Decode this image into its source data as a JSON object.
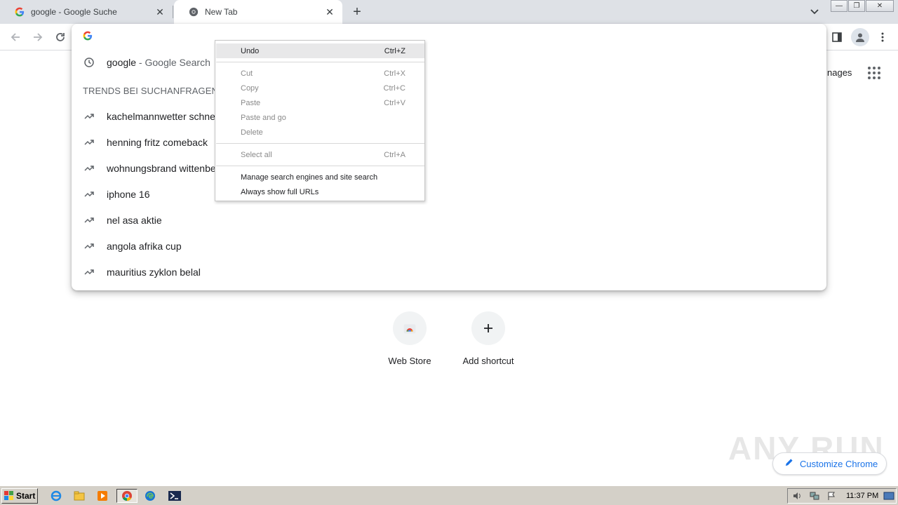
{
  "tabs": [
    {
      "title": "google - Google Suche",
      "active": false
    },
    {
      "title": "New Tab",
      "active": true
    }
  ],
  "omnibox": {
    "value": "",
    "history_suggestion": {
      "query": "google",
      "suffix": " - Google Search"
    },
    "trends_header": "TRENDS BEI SUCHANFRAGEN",
    "trends": [
      "kachelmannwetter schnee",
      "henning fritz comeback",
      "wohnungsbrand wittenberg",
      "iphone 16",
      "nel asa aktie",
      "angola afrika cup",
      "mauritius zyklon belal"
    ]
  },
  "context_menu": {
    "items": [
      {
        "label": "Undo",
        "shortcut": "Ctrl+Z",
        "disabled": false
      },
      {
        "label": "Cut",
        "shortcut": "Ctrl+X",
        "disabled": true
      },
      {
        "label": "Copy",
        "shortcut": "Ctrl+C",
        "disabled": true
      },
      {
        "label": "Paste",
        "shortcut": "Ctrl+V",
        "disabled": true
      },
      {
        "label": "Paste and go",
        "shortcut": "",
        "disabled": true
      },
      {
        "label": "Delete",
        "shortcut": "",
        "disabled": true
      },
      {
        "label": "Select all",
        "shortcut": "Ctrl+A",
        "disabled": true
      },
      {
        "label": "Manage search engines and site search",
        "shortcut": "",
        "disabled": false
      },
      {
        "label": "Always show full URLs",
        "shortcut": "",
        "disabled": false
      }
    ]
  },
  "page": {
    "images_link": "nages",
    "shortcuts": [
      {
        "label": "Web Store"
      },
      {
        "label": "Add shortcut"
      }
    ],
    "customize_label": "Customize Chrome",
    "watermark": "ANY RUN"
  },
  "taskbar": {
    "start_label": "Start",
    "clock": "11:37 PM"
  },
  "colors": {
    "accent": "#1a73e8",
    "tabstrip": "#dee1e6",
    "taskbar": "#d4d0c8"
  }
}
